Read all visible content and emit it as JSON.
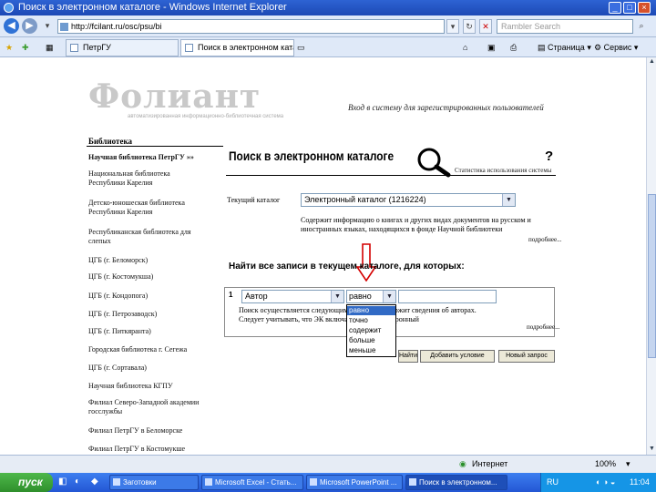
{
  "window": {
    "title": "Поиск в электронном каталоге - Windows Internet Explorer"
  },
  "address_bar": {
    "url": "http://fcilant.ru/osc/psu/bi",
    "search_placeholder": "Rambler Search"
  },
  "tabs": [
    {
      "label": "ПетрГУ"
    },
    {
      "label": "Поиск в электронном ката..."
    }
  ],
  "toolbar": {
    "page_label": "Страница",
    "service_label": "Сервис"
  },
  "page": {
    "logo_text": "Фолиант",
    "logo_subtitle": "автоматизированная информационно-библиотечная система",
    "login_link": "Вход в систему для зарегистрированных пользователей",
    "library_title": "Библиотека",
    "search_heading": "Поиск в электронном каталоге",
    "help_mark": "?",
    "catalog_stats_link": "Статистика использования системы",
    "current_catalog_label": "Текущий каталог",
    "current_catalog_value": "Электронный каталог (1216224)",
    "catalog_description": "Содержит информацию о книгах и других видах документов на русском и иностранных языках, находящихся в фонде Научной библиотеки",
    "more_label": "подробнее...",
    "find_heading": "Найти все записи в текущем каталоге, для которых:",
    "condition_number": "1",
    "field_value": "Автор",
    "operator_value": "равно",
    "field_note": "Поиск осуществляется следующим образом. Содержит сведения об авторах. Следует учитывать, что ЭК включает только электронный",
    "more_label2": "подробнее...",
    "operator_options": [
      "равно",
      "точно",
      "содержит",
      "больше",
      "меньше"
    ],
    "buttons": {
      "find": "Найти",
      "add_condition": "Добавить условие",
      "new_query": "Новый запрос"
    }
  },
  "sidebar": {
    "items": [
      {
        "label": "Научная библиотека ПетрГУ »»",
        "bold": true
      },
      {
        "label": "Национальная библиотека Республики Карелия"
      },
      {
        "label": "Детско-юношеская библиотека Республики Карелия"
      },
      {
        "label": "Республиканская библиотека для слепых"
      },
      {
        "label": "ЦГБ (г. Беломорск)"
      },
      {
        "label": "ЦГБ (г. Костомукша)"
      },
      {
        "label": "ЦГБ (г. Кондопога)"
      },
      {
        "label": "ЦГБ (г. Петрозаводск)"
      },
      {
        "label": "ЦГБ (г. Питкяранта)"
      },
      {
        "label": "Городская библиотека г. Сегежа"
      },
      {
        "label": "ЦГБ (г. Сортавала)"
      },
      {
        "label": "Научная библиотека КГПУ"
      },
      {
        "label": "Филиал Северо-Западной академии госслужбы"
      },
      {
        "label": "Филиал ПетрГУ в Беломорске"
      },
      {
        "label": "Филиал ПетрГУ в Костомукше"
      }
    ]
  },
  "status_bar": {
    "zone": "Интернет",
    "zoom": "100%"
  },
  "taskbar": {
    "start_label": "пуск",
    "tasks": [
      {
        "label": "Заготовки"
      },
      {
        "label": "Microsoft Excel - Стать..."
      },
      {
        "label": "Microsoft PowerPoint ..."
      },
      {
        "label": "Поиск в электронном..."
      }
    ],
    "lang": "RU",
    "time": "11:04"
  },
  "colors": {
    "title_bar": "#1d49b5",
    "selected_option": "#316ac5",
    "arrow": "#d40000"
  }
}
